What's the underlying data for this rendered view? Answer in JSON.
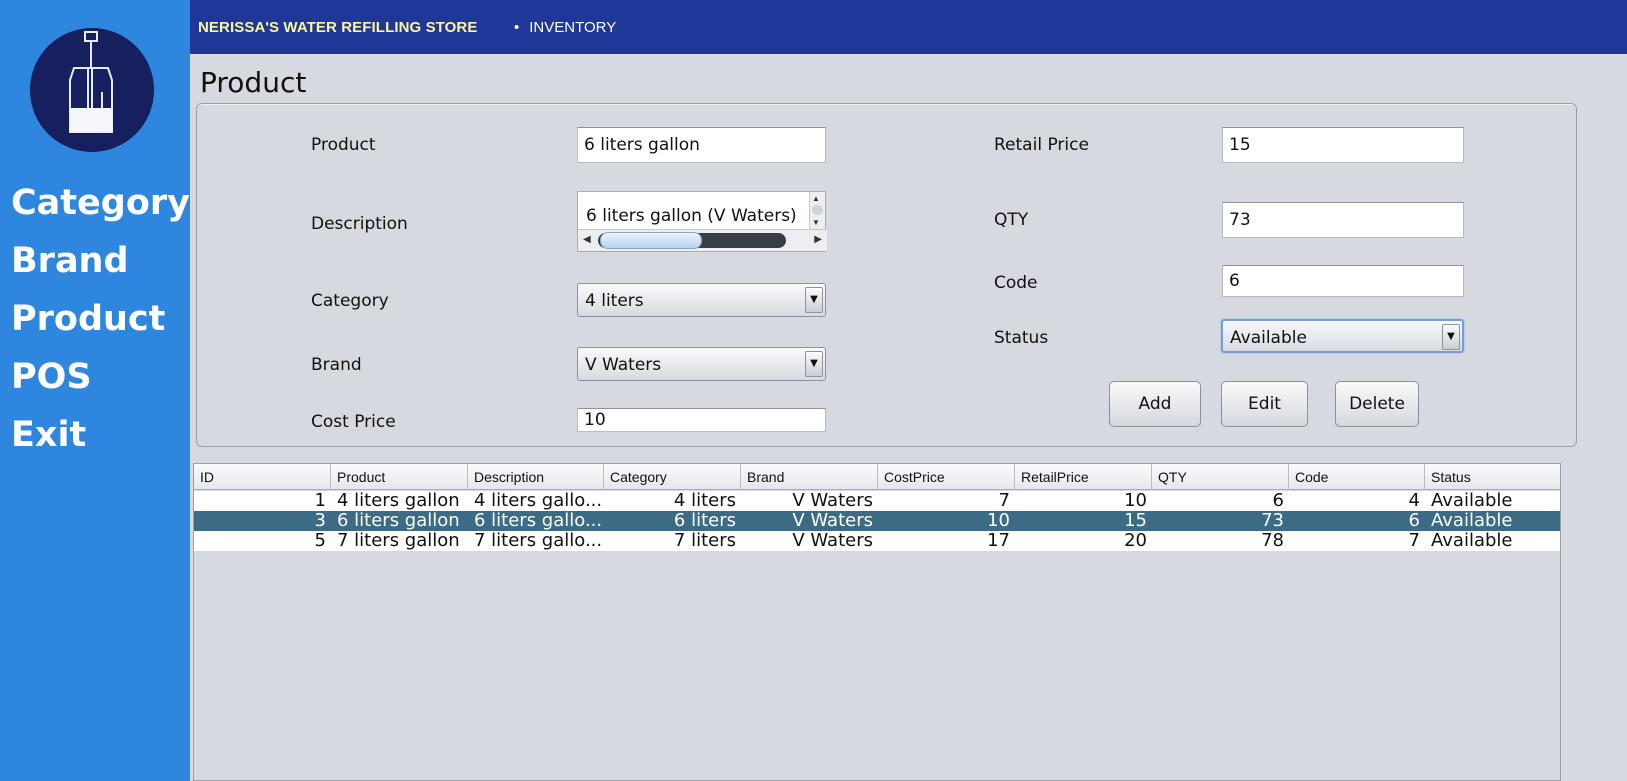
{
  "app": {
    "store_name": "NERISSA'S WATER REFILLING STORE",
    "breadcrumb": "INVENTORY"
  },
  "sidebar": {
    "logo_icon": "water-gallon-icon",
    "items": [
      {
        "label": "Category"
      },
      {
        "label": "Brand"
      },
      {
        "label": "Product"
      },
      {
        "label": "POS"
      },
      {
        "label": "Exit"
      }
    ]
  },
  "page": {
    "title": "Product"
  },
  "form": {
    "product_label": "Product",
    "product_value": "6 liters gallon",
    "description_label": "Description",
    "description_value": "6 liters gallon (V Waters)",
    "category_label": "Category",
    "category_value": "4 liters",
    "brand_label": "Brand",
    "brand_value": "V Waters",
    "cost_price_label": "Cost Price",
    "cost_price_value": "10",
    "retail_price_label": "Retail Price",
    "retail_price_value": "15",
    "qty_label": "QTY",
    "qty_value": "73",
    "code_label": "Code",
    "code_value": "6",
    "status_label": "Status",
    "status_value": "Available",
    "add_label": "Add",
    "edit_label": "Edit",
    "delete_label": "Delete"
  },
  "table": {
    "columns": [
      "ID",
      "Product",
      "Description",
      "Category",
      "Brand",
      "CostPrice",
      "RetailPrice",
      "QTY",
      "Code",
      "Status"
    ],
    "rows": [
      {
        "id": "1",
        "product": "4 liters gallon",
        "description": "4 liters gallo...",
        "category": "4 liters",
        "brand": "V Waters",
        "cost": "7",
        "retail": "10",
        "qty": "6",
        "code": "4",
        "status": "Available",
        "selected": false
      },
      {
        "id": "3",
        "product": "6 liters gallon",
        "description": "6 liters gallo...",
        "category": "6 liters",
        "brand": "V Waters",
        "cost": "10",
        "retail": "15",
        "qty": "73",
        "code": "6",
        "status": "Available",
        "selected": true
      },
      {
        "id": "5",
        "product": "7 liters gallon",
        "description": "7 liters gallo...",
        "category": "7 liters",
        "brand": "V Waters",
        "cost": "17",
        "retail": "20",
        "qty": "78",
        "code": "7",
        "status": "Available",
        "selected": false
      }
    ]
  },
  "colors": {
    "sidebar": "#2f86df",
    "topbar": "#1f3799",
    "store_name": "#fcf59d",
    "selected_row": "#3c6b86"
  }
}
